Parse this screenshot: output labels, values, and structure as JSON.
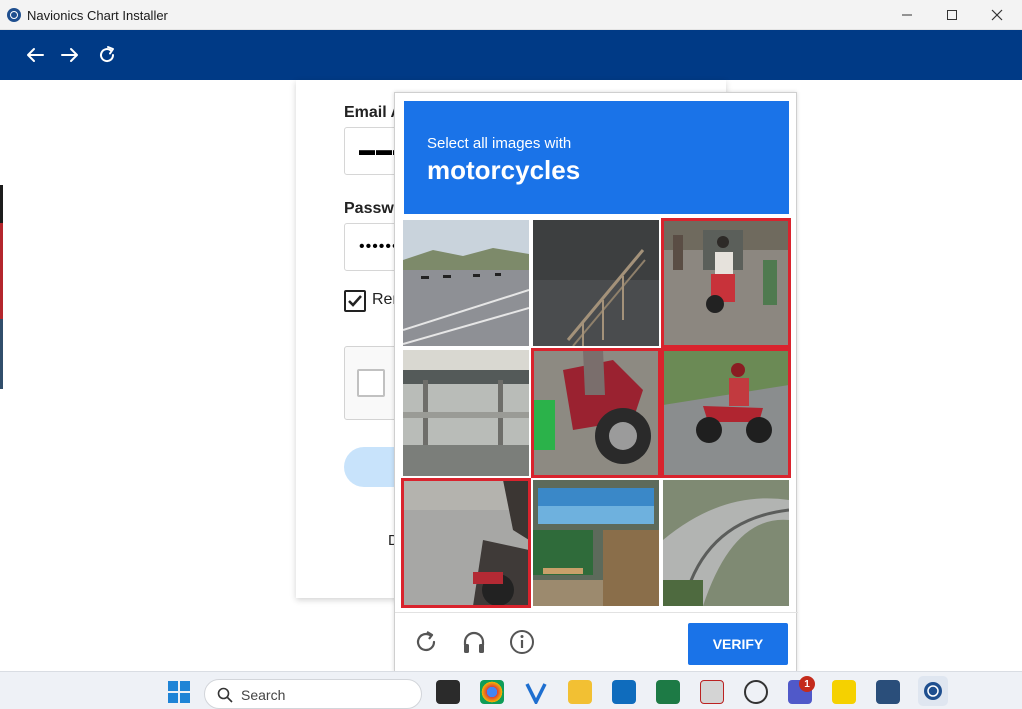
{
  "window": {
    "title": "Navionics Chart Installer"
  },
  "login": {
    "email_label": "Email A",
    "email_value": "▬▬▬▬▬",
    "password_label": "Passwo",
    "password_value": "•••••••",
    "remember_label": "Ren",
    "remember_checked": true,
    "footer_text": "D"
  },
  "captcha": {
    "instruction": "Select all images with",
    "target": "motorcycles",
    "verify_label": "VERIFY",
    "tiles": [
      {
        "name": "tile-highway",
        "selected": false
      },
      {
        "name": "tile-stair-railing",
        "selected": false
      },
      {
        "name": "tile-street-motorcycles",
        "selected": true
      },
      {
        "name": "tile-bus-stop",
        "selected": false
      },
      {
        "name": "tile-red-motorcycle-closeup",
        "selected": true
      },
      {
        "name": "tile-motorcycle-rider",
        "selected": true
      },
      {
        "name": "tile-motorcycle-blurred",
        "selected": true
      },
      {
        "name": "tile-shop-storefront",
        "selected": false
      },
      {
        "name": "tile-curved-road",
        "selected": false
      }
    ]
  },
  "taskbar": {
    "search_label": "Search",
    "teams_badge": "1"
  }
}
